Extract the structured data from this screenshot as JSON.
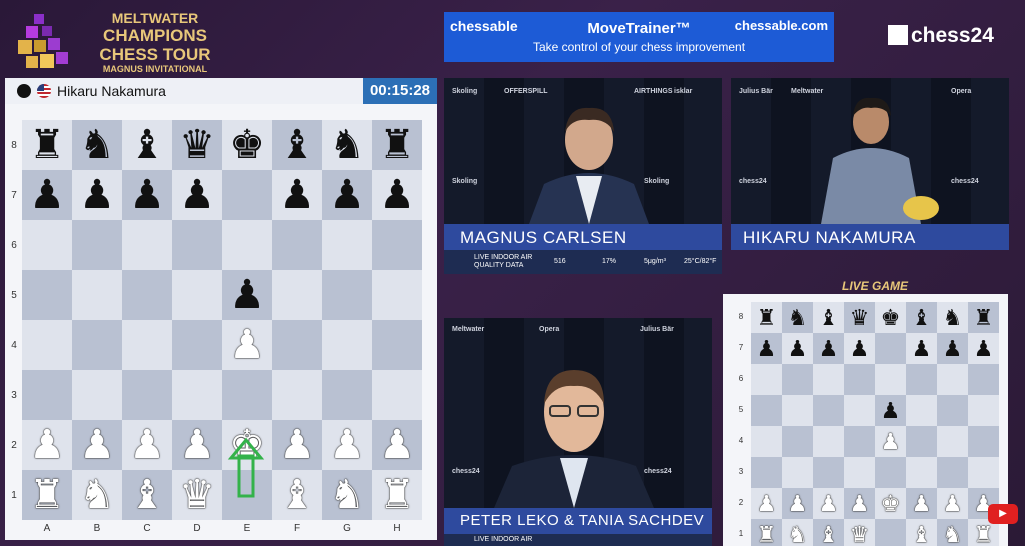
{
  "logo": {
    "line1": "MELTWATER",
    "line2": "CHAMPIONS",
    "line3": "CHESS TOUR",
    "line4": "MAGNUS INVITATIONAL"
  },
  "banner": {
    "brand": "chessable",
    "title": "MoveTrainer™",
    "subtitle": "Take control of your chess improvement",
    "url": "chessable.com"
  },
  "chess24_logo": "chess24",
  "player": {
    "name": "Hikaru Nakamura",
    "clock": "00:15:28"
  },
  "board": {
    "ranks": [
      "8",
      "7",
      "6",
      "5",
      "4",
      "3",
      "2",
      "1"
    ],
    "files": [
      "A",
      "B",
      "C",
      "D",
      "E",
      "F",
      "G",
      "H"
    ],
    "position": [
      [
        "r",
        "n",
        "b",
        "q",
        "k",
        "b",
        "n",
        "r"
      ],
      [
        "p",
        "p",
        "p",
        "p",
        "",
        "p",
        "p",
        "p"
      ],
      [
        "",
        "",
        "",
        "",
        "",
        "",
        "",
        ""
      ],
      [
        "",
        "",
        "",
        "",
        "p",
        "",
        "",
        ""
      ],
      [
        "",
        "",
        "",
        "",
        "P",
        "",
        "",
        ""
      ],
      [
        "",
        "",
        "",
        "",
        "",
        "",
        "",
        ""
      ],
      [
        "P",
        "P",
        "P",
        "P",
        "K",
        "P",
        "P",
        "P"
      ],
      [
        "R",
        "N",
        "B",
        "Q",
        "",
        "B",
        "N",
        "R"
      ]
    ]
  },
  "cams": {
    "carlsen": {
      "name": "MAGNUS CARLSEN"
    },
    "nakamura": {
      "name": "HIKARU NAKAMURA"
    },
    "commentary": {
      "name": "PETER LEKO & TANIA SACHDEV"
    }
  },
  "air": {
    "label": "LIVE INDOOR AIR QUALITY DATA",
    "co2": "516",
    "humidity": "17%",
    "pm": "5μg/m³",
    "temp": "25°C/82°F"
  },
  "air_bottom": "LIVE INDOOR AIR",
  "sponsors": [
    "Skoling",
    "OFFERSPILL",
    "Julius Bär",
    "AIRTHINGS",
    "isklar",
    "Opera",
    "Meltwater",
    "chess24"
  ],
  "live_game": {
    "label": "LIVE GAME"
  },
  "mini_board": {
    "ranks": [
      "8",
      "7",
      "6",
      "5",
      "4",
      "3",
      "2",
      "1"
    ],
    "position": [
      [
        "r",
        "n",
        "b",
        "q",
        "k",
        "b",
        "n",
        "r"
      ],
      [
        "p",
        "p",
        "p",
        "p",
        "",
        "p",
        "p",
        "p"
      ],
      [
        "",
        "",
        "",
        "",
        "",
        "",
        "",
        ""
      ],
      [
        "",
        "",
        "",
        "",
        "p",
        "",
        "",
        ""
      ],
      [
        "",
        "",
        "",
        "",
        "P",
        "",
        "",
        ""
      ],
      [
        "",
        "",
        "",
        "",
        "",
        "",
        "",
        ""
      ],
      [
        "P",
        "P",
        "P",
        "P",
        "K",
        "P",
        "P",
        "P"
      ],
      [
        "R",
        "N",
        "B",
        "Q",
        "",
        "B",
        "N",
        "R"
      ]
    ]
  },
  "youtube": {
    "label": "▶"
  },
  "colors": {
    "accent_blue": "#2c6fb6",
    "banner_blue": "#1d5bd6",
    "gold": "#e8c77a",
    "namebar": "#2e4a9e",
    "arrow_green": "#33b24a"
  }
}
